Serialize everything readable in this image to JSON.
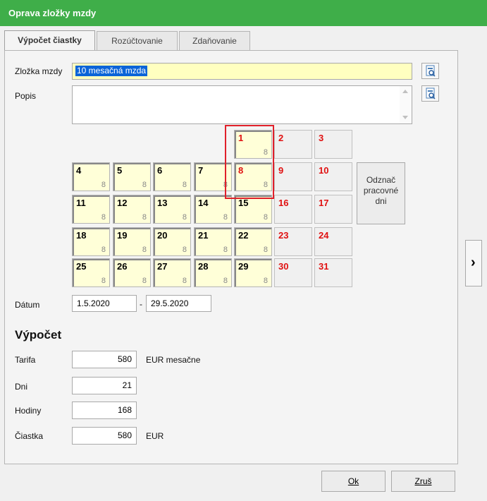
{
  "window": {
    "title": "Oprava zložky mzdy"
  },
  "tabs": [
    "Výpočet čiastky",
    "Rozúčtovanie",
    "Zdaňovanie"
  ],
  "fields": {
    "zlozka_label": "Zložka mzdy",
    "zlozka_value": "10  mesačná mzda",
    "popis_label": "Popis",
    "popis_value": ""
  },
  "calendar": {
    "days": [
      {
        "n": "1",
        "h": "8"
      },
      {
        "n": "2",
        "h": ""
      },
      {
        "n": "3",
        "h": ""
      },
      {
        "n": "4",
        "h": "8"
      },
      {
        "n": "5",
        "h": "8"
      },
      {
        "n": "6",
        "h": "8"
      },
      {
        "n": "7",
        "h": "8"
      },
      {
        "n": "8",
        "h": "8"
      },
      {
        "n": "9",
        "h": ""
      },
      {
        "n": "10",
        "h": ""
      },
      {
        "n": "11",
        "h": "8"
      },
      {
        "n": "12",
        "h": "8"
      },
      {
        "n": "13",
        "h": "8"
      },
      {
        "n": "14",
        "h": "8"
      },
      {
        "n": "15",
        "h": "8"
      },
      {
        "n": "16",
        "h": ""
      },
      {
        "n": "17",
        "h": ""
      },
      {
        "n": "18",
        "h": "8"
      },
      {
        "n": "19",
        "h": "8"
      },
      {
        "n": "20",
        "h": "8"
      },
      {
        "n": "21",
        "h": "8"
      },
      {
        "n": "22",
        "h": "8"
      },
      {
        "n": "23",
        "h": ""
      },
      {
        "n": "24",
        "h": ""
      },
      {
        "n": "25",
        "h": "8"
      },
      {
        "n": "26",
        "h": "8"
      },
      {
        "n": "27",
        "h": "8"
      },
      {
        "n": "28",
        "h": "8"
      },
      {
        "n": "29",
        "h": "8"
      },
      {
        "n": "30",
        "h": ""
      },
      {
        "n": "31",
        "h": ""
      }
    ],
    "unmark_button": "Odznač\npracovné\ndni"
  },
  "datum": {
    "label": "Dátum",
    "from": "1.5.2020",
    "sep": "-",
    "to": "29.5.2020"
  },
  "vypocet": {
    "heading": "Výpočet",
    "rows": [
      {
        "label": "Tarifa",
        "value": "580",
        "unit": "EUR mesačne"
      },
      {
        "label": "Dni",
        "value": "21",
        "unit": ""
      },
      {
        "label": "Hodiny",
        "value": "168",
        "unit": ""
      },
      {
        "label": "Čiastka",
        "value": "580",
        "unit": "EUR"
      }
    ]
  },
  "buttons": {
    "ok": "Ok",
    "cancel": "Zruš",
    "expand_glyph": "›"
  },
  "colors": {
    "titlebar": "#3fae49",
    "weekend_text": "#e01010",
    "selection": "#0a64d8"
  }
}
